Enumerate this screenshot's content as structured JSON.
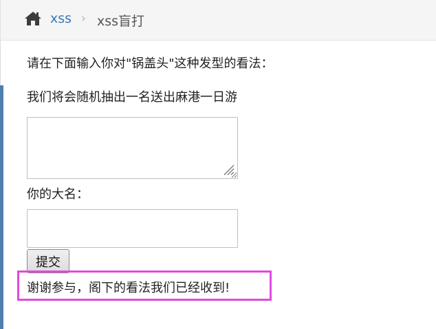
{
  "breadcrumb": {
    "home_icon": "home-icon",
    "link": "xss",
    "separator": "›",
    "current": "xss盲打"
  },
  "form": {
    "question_line1": "请在下面输入你对\"锅盖头\"这种发型的看法：",
    "question_line2": "我们将会随机抽出一名送出麻港一日游",
    "comment_value": "",
    "name_label": "你的大名：",
    "name_value": "",
    "submit_label": "提交"
  },
  "result": {
    "message": "谢谢参与，阁下的看法我们已经收到!",
    "highlight_color": "#e048e0"
  },
  "colors": {
    "link": "#3a78b8",
    "accent": "#4f7fae"
  }
}
